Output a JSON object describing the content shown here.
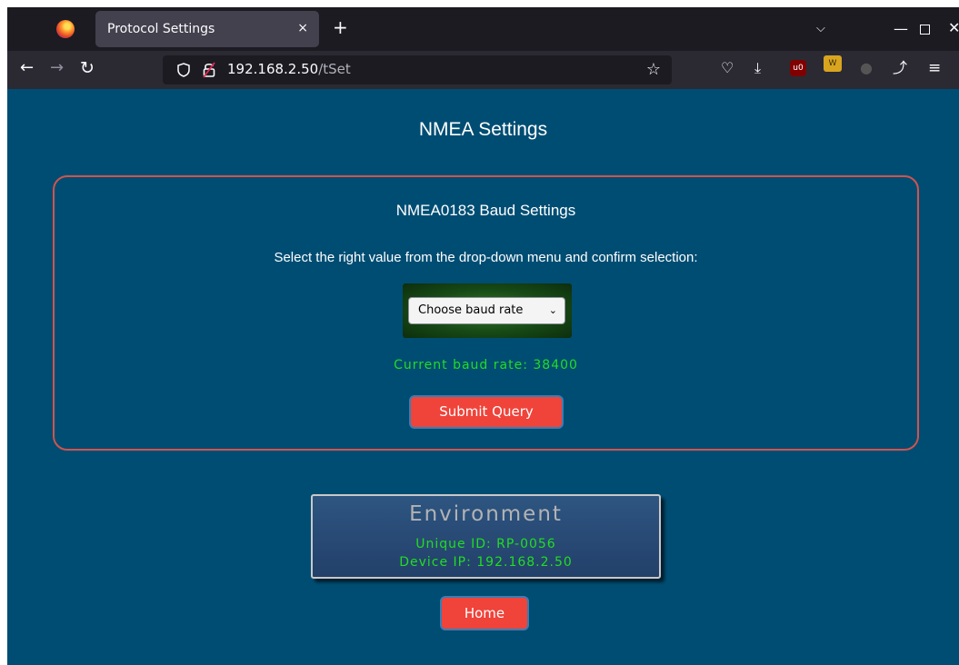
{
  "browser": {
    "tab_title": "Protocol Settings",
    "tab_close": "×",
    "new_tab": "+",
    "url_host": "192.168.2.50",
    "url_path": "/tSet",
    "icons": [
      "firefox-logo",
      "back-arrow",
      "forward-arrow",
      "reload",
      "tracking-shield",
      "connection-lock",
      "bookmark-star",
      "pocket",
      "downloads",
      "ublock-origin",
      "wappalyzer",
      "extension",
      "extensions-puzzle",
      "menu"
    ]
  },
  "page": {
    "title": "NMEA Settings",
    "panel": {
      "title": "NMEA0183 Baud Settings",
      "instruction": "Select the right value from the drop-down menu and confirm selection:",
      "select_value": "Choose baud rate",
      "current_baud": "Current baud rate: 38400",
      "submit_label": "Submit Query"
    },
    "environment": {
      "title": "Environment",
      "unique_id": "Unique ID: RP-0056",
      "device_ip": "Device IP: 192.168.2.50"
    },
    "home_label": "Home"
  },
  "colors": {
    "page_bg": "#004d73",
    "panel_border": "#d0544e",
    "status_green": "#22dd22",
    "button_red": "#f0433a"
  }
}
